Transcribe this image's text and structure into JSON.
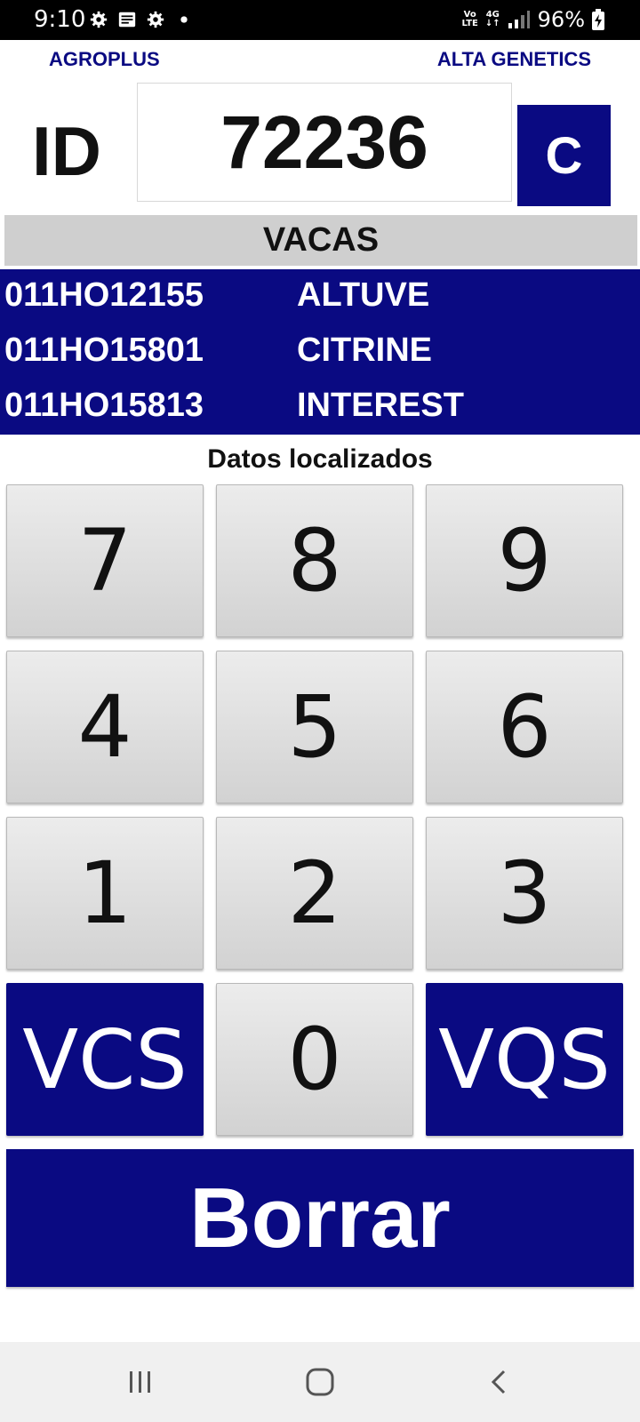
{
  "status_bar": {
    "time": "9:10",
    "network_top": "Vo",
    "network_bottom": "LTE",
    "network_type": "4G",
    "battery": "96%",
    "icons": [
      "gear-icon",
      "message-icon",
      "gear-icon",
      "dot-icon",
      "signal-icon",
      "battery-charging-icon"
    ]
  },
  "header": {
    "left_brand": "AGROPLUS",
    "right_brand": "ALTA GENETICS"
  },
  "id_entry": {
    "label": "ID",
    "value": "72236",
    "clear_label": "C"
  },
  "section_title": "VACAS",
  "results": [
    {
      "code": "011HO12155",
      "name": "ALTUVE"
    },
    {
      "code": "011HO15801",
      "name": "CITRINE"
    },
    {
      "code": "011HO15813",
      "name": "INTEREST"
    }
  ],
  "status_message": "Datos localizados",
  "keypad": {
    "k7": "7",
    "k8": "8",
    "k9": "9",
    "k4": "4",
    "k5": "5",
    "k6": "6",
    "k1": "1",
    "k2": "2",
    "k3": "3",
    "left_action": "VCS",
    "k0": "0",
    "right_action": "VQS"
  },
  "delete_label": "Borrar",
  "nav": {
    "icons": [
      "recent-apps-icon",
      "home-icon",
      "back-icon"
    ]
  },
  "colors": {
    "brand_blue": "#0a0a82",
    "key_gray": "#dcdcdc",
    "bar_gray": "#cfcfcf"
  }
}
